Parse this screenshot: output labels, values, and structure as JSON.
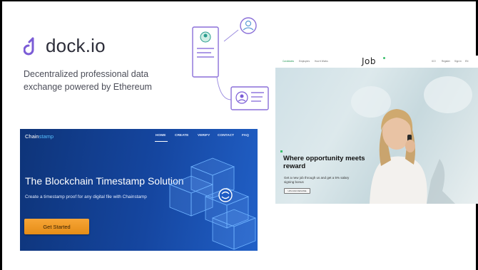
{
  "dock": {
    "name": "dock.io",
    "tagline": "Decentralized professional data exchange powered by Ethereum"
  },
  "chainstamp": {
    "logo_prefix": "Chain",
    "logo_suffix": "stamp",
    "nav": [
      "HOME",
      "CREATE",
      "VERIFY",
      "CONTACT",
      "FAQ"
    ],
    "title": "The Blockchain Timestamp Solution",
    "subtitle": "Create a timestamp proof for any digital file with Chainstamp",
    "cta": "Get Started"
  },
  "job": {
    "logo": "Job",
    "nav": [
      "Candidates",
      "Employers",
      "How it Works"
    ],
    "right_nav": [
      "ICO",
      "Register",
      "Sign In",
      "EN"
    ],
    "headline": "Where opportunity meets reward",
    "subtitle": "Get a new job through us and get a 5% salary signing bonus",
    "cta": "UPLOAD RESUME"
  },
  "colors": {
    "chain_bg": "#1546a0",
    "chain_cta": "#f39a27",
    "dock_accent": "#7b5cd6",
    "job_accent": "#3bbf6c"
  }
}
